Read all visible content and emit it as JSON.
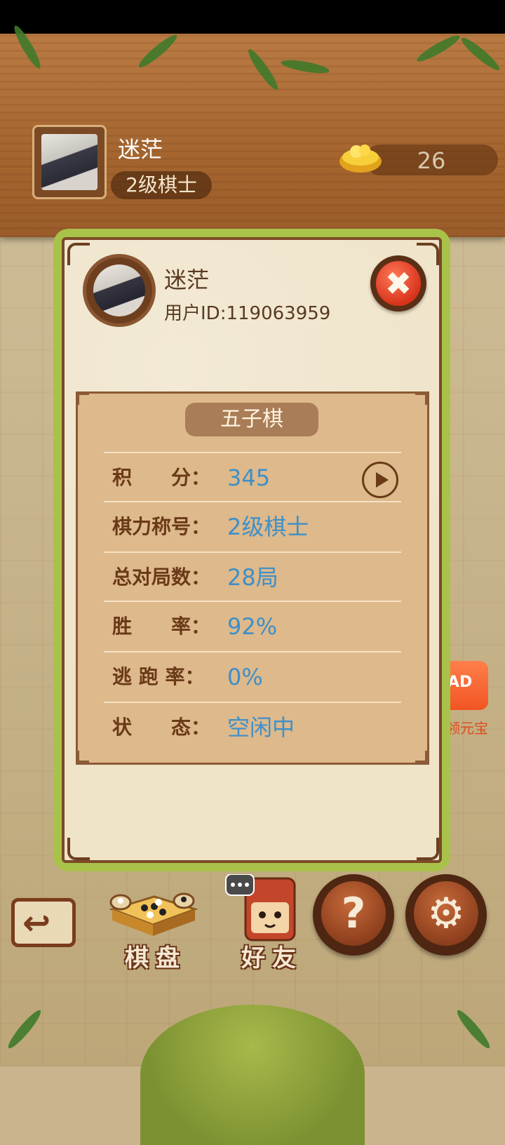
{
  "header": {
    "username": "迷茫",
    "rank": "2级棋士",
    "coin_count": "26"
  },
  "profile_dialog": {
    "name": "迷茫",
    "user_id": "用户ID:119063959",
    "close_icon": "close-x-icon",
    "game_tab": "五子棋",
    "stats": [
      {
        "label": "积　　分：",
        "value": "345"
      },
      {
        "label": "棋力称号：",
        "value": "2级棋士"
      },
      {
        "label": "总对局数：",
        "value": "28局"
      },
      {
        "label": "胜　　率：",
        "value": "92%"
      },
      {
        "label": "逃 跑 率：",
        "value": "0%"
      },
      {
        "label": "状　　态：",
        "value": "空闲中"
      }
    ]
  },
  "side_button": {
    "badge": "AD",
    "label": "领元宝"
  },
  "bottom_bar": {
    "back_icon": "back-arrow-icon",
    "board_label": "棋盘",
    "friends_label": "好友",
    "help_glyph": "?",
    "settings_glyph": "⚙"
  },
  "colors": {
    "value_blue": "#3f8fc8",
    "label_brown": "#6a3a18",
    "dialog_border_green": "#a9c24a"
  }
}
